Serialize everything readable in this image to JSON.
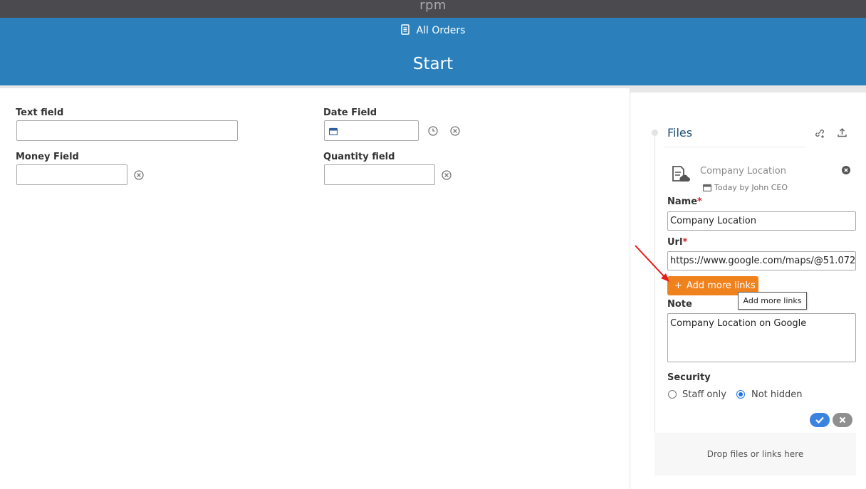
{
  "app": {
    "brand": "rpm"
  },
  "header": {
    "breadcrumb": "All Orders",
    "title": "Start"
  },
  "form": {
    "text_field": {
      "label": "Text field",
      "value": ""
    },
    "date_field": {
      "label": "Date Field",
      "value": ""
    },
    "money_field": {
      "label": "Money Field",
      "value": ""
    },
    "quantity_field": {
      "label": "Quantity field",
      "value": ""
    }
  },
  "files": {
    "title": "Files",
    "item": {
      "title": "Company Location",
      "date": "Today",
      "author": "by John CEO"
    },
    "name_label": "Name",
    "name_value": "Company Location",
    "url_label": "Url",
    "url_value": "https://www.google.com/maps/@51.072",
    "required_mark": "*",
    "add_links_button": "Add more links",
    "add_links_icon": "+",
    "tooltip": "Add more links",
    "note_label": "Note",
    "note_value": "Company Location on Google",
    "security_label": "Security",
    "security_options": [
      "Staff only",
      "Not hidden"
    ],
    "security_selected": "Not hidden",
    "drop_text": "Drop files or links here"
  },
  "colors": {
    "header": "#2b80bb",
    "topbar": "#4b4b4f",
    "accent": "#f0821e",
    "confirm": "#3b83e0",
    "required": "#d9232d"
  }
}
